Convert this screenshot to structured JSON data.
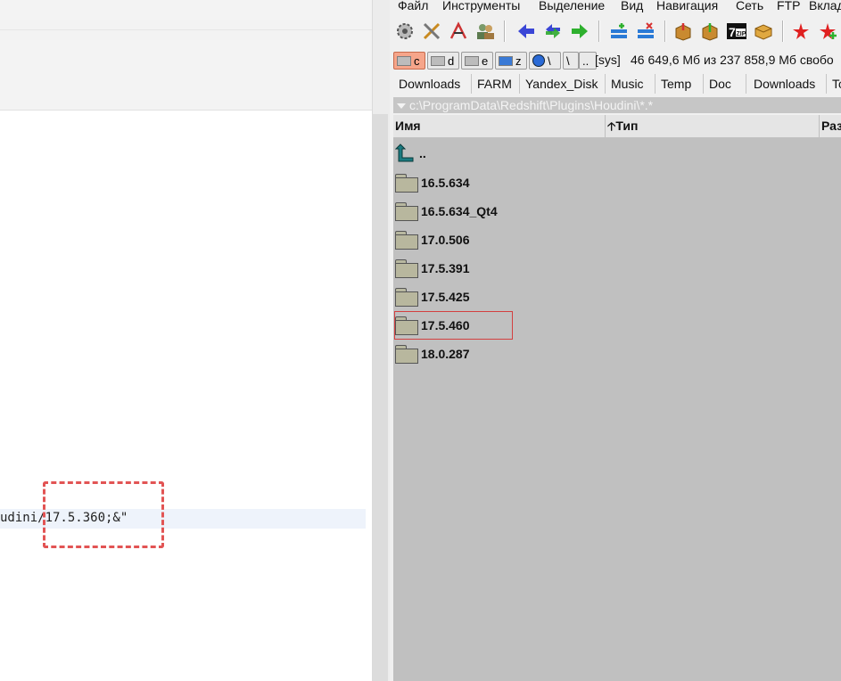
{
  "editor": {
    "code_fragment": "udini/17.5.360;&\""
  },
  "file_manager": {
    "menu": [
      "Файл",
      "Инструменты",
      "Выделение",
      "Вид",
      "Навигация",
      "Сеть",
      "FTP",
      "Вклад"
    ],
    "toolbar_icons": [
      "settings-icon",
      "tools-icon",
      "font-icon",
      "users-icon",
      "arrow-left-icon",
      "sync-icon",
      "arrow-right-icon",
      "new-tab-icon",
      "new-tab-close-icon",
      "pack-icon",
      "unpack-icon",
      "7zip-icon",
      "archive-box-icon",
      "star-red-icon",
      "star-add-icon"
    ],
    "drives": [
      {
        "letter": "c",
        "active": true
      },
      {
        "letter": "d",
        "active": false
      },
      {
        "letter": "e",
        "active": false
      },
      {
        "letter": "z",
        "active": false
      },
      {
        "letter": "\\",
        "active": false
      },
      {
        "letter": "..",
        "active": false
      }
    ],
    "disk_label": "[sys]",
    "disk_info": "46 649,6 Мб из 237 858,9 Мб свобо",
    "tabs": [
      "Downloads",
      "FARM",
      "Yandex_Disk",
      "Music",
      "Temp",
      "Doc",
      "Downloads",
      "To"
    ],
    "path": "c:\\ProgramData\\Redshift\\Plugins\\Houdini\\*.*",
    "columns": {
      "name": "Имя",
      "type": "Тип",
      "size": "Раз"
    },
    "up_label": "..",
    "folders": [
      "16.5.634",
      "16.5.634_Qt4",
      "17.0.506",
      "17.5.391",
      "17.5.425",
      "17.5.460",
      "18.0.287"
    ],
    "highlighted_folder": "17.5.460"
  }
}
